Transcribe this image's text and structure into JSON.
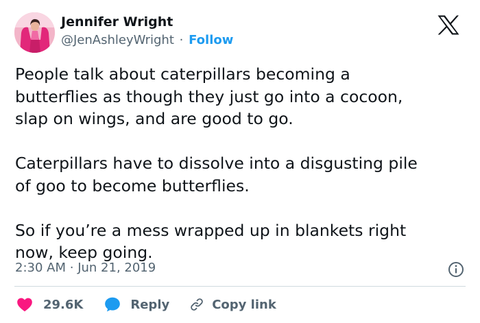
{
  "author": {
    "name": "Jennifer Wright",
    "handle": "@JenAshleyWright",
    "separator": "·",
    "follow_label": "Follow"
  },
  "tweet": {
    "paragraphs": [
      [
        "People talk about caterpillars becoming a",
        "butterflies as though they just go into a cocoon,",
        "slap on wings, and are good to go."
      ],
      [
        "Caterpillars have to dissolve into a disgusting pile",
        "of goo to become butterflies."
      ],
      [
        "So if you’re a mess wrapped up in blankets right",
        "now, keep going."
      ]
    ],
    "time": "2:30 AM",
    "separator": "·",
    "date": "Jun 21, 2019"
  },
  "actions": {
    "likes": "29.6K",
    "reply_label": "Reply",
    "copy_link_label": "Copy link"
  },
  "icons": {
    "logo": "x-logo-icon",
    "info": "info-icon",
    "like": "heart-icon",
    "reply": "speech-bubble-icon",
    "copy": "link-icon"
  },
  "colors": {
    "accent": "#1d9bf0",
    "like": "#f91880",
    "text": "#0f1419",
    "secondary": "#536471"
  }
}
